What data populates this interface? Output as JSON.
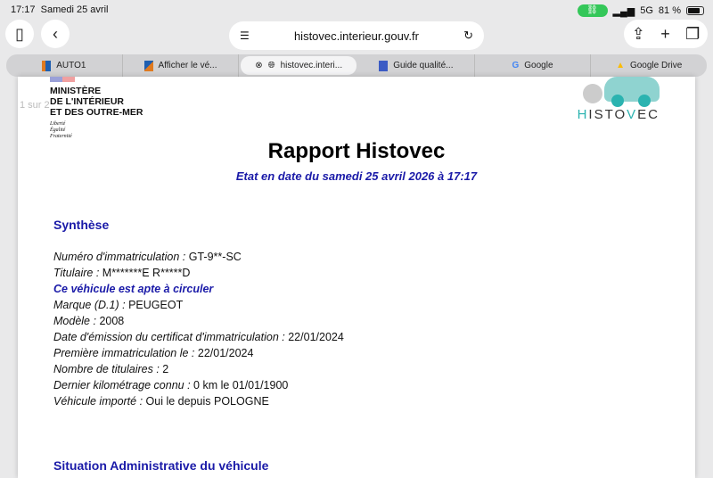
{
  "status": {
    "time": "17:17",
    "date": "Samedi 25 avril",
    "network": "5G",
    "battery": "81 %"
  },
  "browser": {
    "url": "histovec.interieur.gouv.fr",
    "tabs": [
      {
        "label": "AUTO1",
        "color": "#1f5fb0"
      },
      {
        "label": "Afficher le vé...",
        "color": "#e07a1f"
      },
      {
        "label": "histovec.interi...",
        "color": "#333"
      },
      {
        "label": "Guide qualité...",
        "color": "#3b5bc4"
      },
      {
        "label": "Google",
        "color": "#4285f4"
      },
      {
        "label": "Google Drive",
        "color": "#fbbc04"
      }
    ]
  },
  "page": {
    "page_indicator": "1 sur 2",
    "ministry": [
      "MINISTÈRE",
      "DE L'INTÉRIEUR",
      "ET DES OUTRE-MER"
    ],
    "motto": [
      "Liberté",
      "Égalité",
      "Fraternité"
    ],
    "logo": "HISTOVEC",
    "title": "Rapport Histovec",
    "subtitle": "Etat en date du samedi 25 avril 2026 à 17:17",
    "section1": "Synthèse",
    "fields": [
      {
        "label": "Numéro d'immatriculation :",
        "value": "GT-9**-SC"
      },
      {
        "label": "Titulaire :",
        "value": "M*******E R*****D"
      },
      {
        "highlight": "Ce véhicule est apte à circuler"
      },
      {
        "label": "Marque (D.1) :",
        "value": "PEUGEOT"
      },
      {
        "label": "Modèle :",
        "value": "2008"
      },
      {
        "label": "Date d'émission du certificat d'immatriculation :",
        "value": "22/01/2024"
      },
      {
        "label": "Première immatriculation le  :",
        "value": "22/01/2024"
      },
      {
        "label": "Nombre de titulaires :",
        "value": "2"
      },
      {
        "label": "Dernier kilométrage connu :",
        "value": "0 km le 01/01/1900"
      },
      {
        "label": "Véhicule importé :",
        "value": "Oui le  depuis POLOGNE"
      }
    ],
    "section2": "Situation Administrative du véhicule"
  }
}
